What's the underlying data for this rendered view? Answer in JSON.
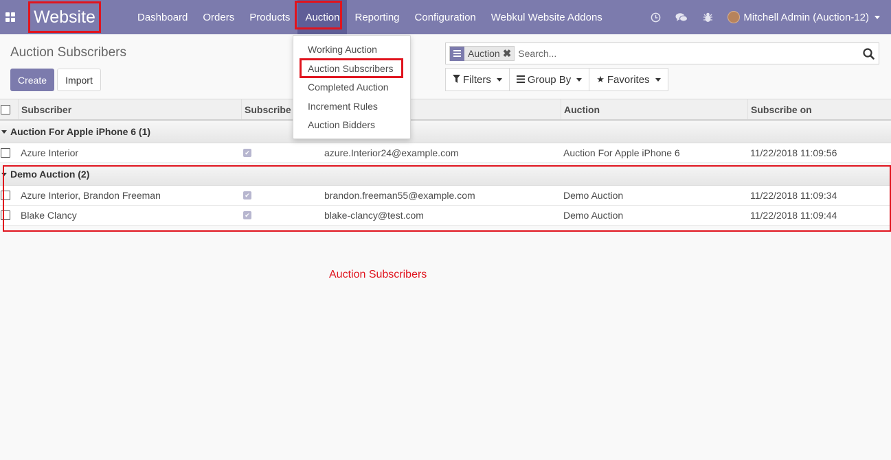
{
  "navbar": {
    "brand": "Website",
    "menu": [
      "Dashboard",
      "Orders",
      "Products",
      "Auction",
      "Reporting",
      "Configuration",
      "Webkul Website Addons"
    ],
    "active_menu": "Auction",
    "user": "Mitchell Admin (Auction-12)",
    "icons": [
      "clock-icon",
      "chat-icon",
      "bug-icon"
    ]
  },
  "control_panel": {
    "title": "Auction Subscribers",
    "create_label": "Create",
    "import_label": "Import"
  },
  "search": {
    "facet_value": "Auction",
    "placeholder": "Search...",
    "filters_label": "Filters",
    "groupby_label": "Group By",
    "favorites_label": "Favorites"
  },
  "dropdown": {
    "items": [
      "Working Auction",
      "Auction Subscribers",
      "Completed Auction",
      "Increment Rules",
      "Auction Bidders"
    ],
    "highlighted": "Auction Subscribers"
  },
  "table": {
    "columns": [
      "Subscriber",
      "Subscribe",
      "",
      "Auction",
      "Subscribe on"
    ],
    "groups": [
      {
        "label": "Auction For Apple iPhone 6 (1)",
        "rows": [
          {
            "subscriber": "Azure Interior",
            "subscribed": true,
            "email": "azure.Interior24@example.com",
            "auction": "Auction For Apple iPhone 6",
            "date": "11/22/2018 11:09:56"
          }
        ]
      },
      {
        "label": "Demo Auction (2)",
        "rows": [
          {
            "subscriber": "Azure Interior, Brandon Freeman",
            "subscribed": true,
            "email": "brandon.freeman55@example.com",
            "auction": "Demo Auction",
            "date": "11/22/2018 11:09:34"
          },
          {
            "subscriber": "Blake Clancy",
            "subscribed": true,
            "email": "blake-clancy@test.com",
            "auction": "Demo Auction",
            "date": "11/22/2018 11:09:44"
          }
        ]
      }
    ]
  },
  "caption": "Auction Subscribers",
  "colors": {
    "navbar": "#7c7bad",
    "annotation_red": "#e0141e"
  }
}
